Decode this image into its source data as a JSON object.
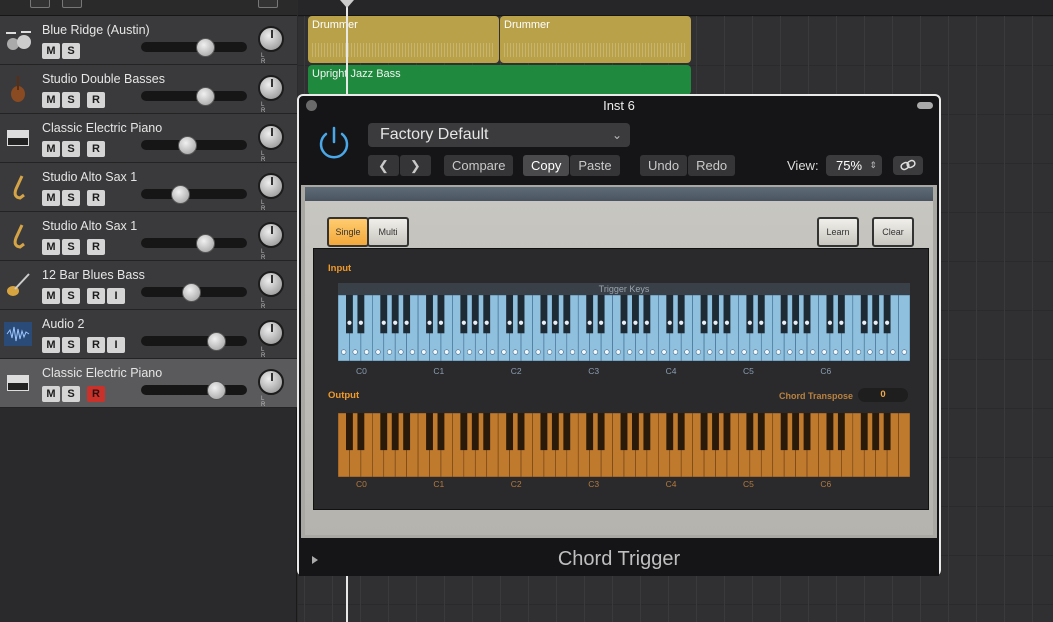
{
  "tracks": [
    {
      "name": "Blue Ridge (Austin)",
      "icon": "drum-kit-icon",
      "buttons": [
        "M",
        "S"
      ],
      "fader": 0.6,
      "selected": false
    },
    {
      "name": "Studio Double Basses",
      "icon": "double-bass-icon",
      "buttons": [
        "M",
        "S",
        "R"
      ],
      "fader": 0.6,
      "selected": false
    },
    {
      "name": "Classic Electric Piano",
      "icon": "electric-piano-icon",
      "buttons": [
        "M",
        "S",
        "R"
      ],
      "fader": 0.43,
      "selected": false
    },
    {
      "name": "Studio Alto Sax 1",
      "icon": "saxophone-icon",
      "buttons": [
        "M",
        "S",
        "R"
      ],
      "fader": 0.37,
      "selected": false
    },
    {
      "name": "Studio Alto Sax 1",
      "icon": "saxophone-icon",
      "buttons": [
        "M",
        "S",
        "R"
      ],
      "fader": 0.6,
      "selected": false
    },
    {
      "name": "12 Bar Blues Bass",
      "icon": "bass-guitar-icon",
      "buttons": [
        "M",
        "S",
        "R",
        "I"
      ],
      "fader": 0.47,
      "selected": false
    },
    {
      "name": "Audio 2",
      "icon": "audio-waveform-icon",
      "buttons": [
        "M",
        "S",
        "R",
        "I"
      ],
      "fader": 0.71,
      "selected": false
    },
    {
      "name": "Classic Electric Piano",
      "icon": "electric-piano-icon",
      "buttons": [
        "M",
        "S",
        "R"
      ],
      "fader": 0.71,
      "selected": true,
      "record_armed": true
    }
  ],
  "pan_label": "L R",
  "regions": [
    {
      "name": "Drummer",
      "type": "drum"
    },
    {
      "name": "Drummer",
      "type": "drum"
    },
    {
      "name": "Upright Jazz Bass",
      "type": "bass"
    }
  ],
  "plugin": {
    "window_title": "Inst 6",
    "preset": "Factory Default",
    "compare": "Compare",
    "copy": "Copy",
    "paste": "Paste",
    "undo": "Undo",
    "redo": "Redo",
    "view_label": "View:",
    "view_value": "75%",
    "single": "Single",
    "multi": "Multi",
    "learn": "Learn",
    "clear": "Clear",
    "input_label": "Input",
    "trigger_keys": "Trigger Keys",
    "output_label": "Output",
    "chord_transpose_label": "Chord Transpose",
    "chord_transpose_value": "0",
    "octaves": [
      "C0",
      "C1",
      "C2",
      "C3",
      "C4",
      "C5",
      "C6"
    ],
    "plugin_name": "Chord Trigger"
  }
}
